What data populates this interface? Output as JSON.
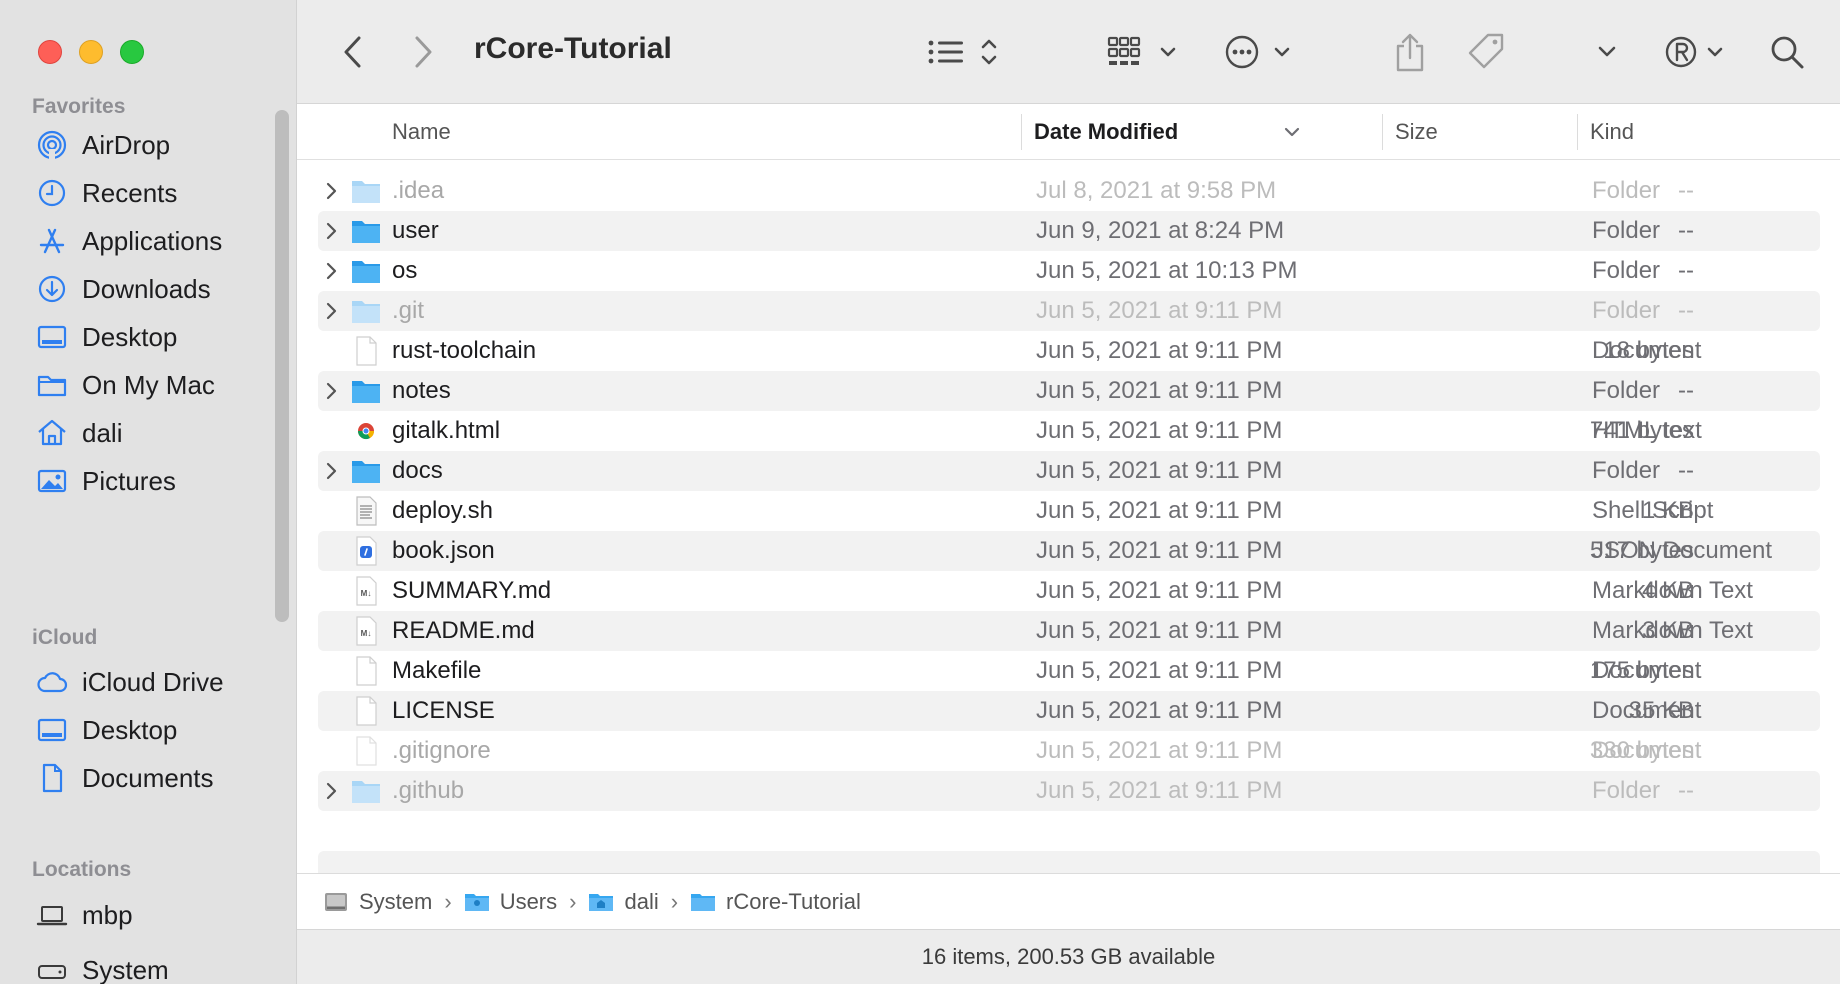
{
  "window": {
    "title": "rCore-Tutorial"
  },
  "sidebar": {
    "sections": [
      {
        "label": "Favorites",
        "items": [
          {
            "label": "AirDrop",
            "icon": "airdrop-icon"
          },
          {
            "label": "Recents",
            "icon": "clock-icon"
          },
          {
            "label": "Applications",
            "icon": "applications-icon"
          },
          {
            "label": "Downloads",
            "icon": "download-icon"
          },
          {
            "label": "Desktop",
            "icon": "desktop-icon"
          },
          {
            "label": "On My Mac",
            "icon": "folder-icon"
          },
          {
            "label": "dali",
            "icon": "home-icon"
          },
          {
            "label": "Pictures",
            "icon": "pictures-icon"
          }
        ]
      },
      {
        "label": "iCloud",
        "items": [
          {
            "label": "iCloud Drive",
            "icon": "cloud-icon"
          },
          {
            "label": "Desktop",
            "icon": "desktop-icon"
          },
          {
            "label": "Documents",
            "icon": "document-icon"
          }
        ]
      },
      {
        "label": "Locations",
        "items": [
          {
            "label": "mbp",
            "icon": "laptop-icon"
          },
          {
            "label": "System",
            "icon": "drive-icon"
          }
        ]
      }
    ]
  },
  "columns": {
    "name": "Name",
    "date": "Date Modified",
    "size": "Size",
    "kind": "Kind"
  },
  "files": [
    {
      "name": ".idea",
      "date": "Jul 8, 2021 at 9:58 PM",
      "size": "--",
      "kind": "Folder",
      "type": "folder",
      "dim": true,
      "expandable": true
    },
    {
      "name": "user",
      "date": "Jun 9, 2021 at 8:24 PM",
      "size": "--",
      "kind": "Folder",
      "type": "folder",
      "dim": false,
      "expandable": true
    },
    {
      "name": "os",
      "date": "Jun 5, 2021 at 10:13 PM",
      "size": "--",
      "kind": "Folder",
      "type": "folder",
      "dim": false,
      "expandable": true
    },
    {
      "name": ".git",
      "date": "Jun 5, 2021 at 9:11 PM",
      "size": "--",
      "kind": "Folder",
      "type": "folder",
      "dim": true,
      "expandable": true
    },
    {
      "name": "rust-toolchain",
      "date": "Jun 5, 2021 at 9:11 PM",
      "size": "18 bytes",
      "kind": "Document",
      "type": "doc",
      "dim": false,
      "expandable": false
    },
    {
      "name": "notes",
      "date": "Jun 5, 2021 at 9:11 PM",
      "size": "--",
      "kind": "Folder",
      "type": "folder",
      "dim": false,
      "expandable": true
    },
    {
      "name": "gitalk.html",
      "date": "Jun 5, 2021 at 9:11 PM",
      "size": "741 bytes",
      "kind": "HTML text",
      "type": "html",
      "dim": false,
      "expandable": false
    },
    {
      "name": "docs",
      "date": "Jun 5, 2021 at 9:11 PM",
      "size": "--",
      "kind": "Folder",
      "type": "folder",
      "dim": false,
      "expandable": true
    },
    {
      "name": "deploy.sh",
      "date": "Jun 5, 2021 at 9:11 PM",
      "size": "1 KB",
      "kind": "Shell Script",
      "type": "script",
      "dim": false,
      "expandable": false
    },
    {
      "name": "book.json",
      "date": "Jun 5, 2021 at 9:11 PM",
      "size": "517 bytes",
      "kind": "JSON Document",
      "type": "json",
      "dim": false,
      "expandable": false
    },
    {
      "name": "SUMMARY.md",
      "date": "Jun 5, 2021 at 9:11 PM",
      "size": "4 KB",
      "kind": "Markdown Text",
      "type": "md",
      "dim": false,
      "expandable": false
    },
    {
      "name": "README.md",
      "date": "Jun 5, 2021 at 9:11 PM",
      "size": "3 KB",
      "kind": "Markdown Text",
      "type": "md",
      "dim": false,
      "expandable": false
    },
    {
      "name": "Makefile",
      "date": "Jun 5, 2021 at 9:11 PM",
      "size": "175 bytes",
      "kind": "Document",
      "type": "doc",
      "dim": false,
      "expandable": false
    },
    {
      "name": "LICENSE",
      "date": "Jun 5, 2021 at 9:11 PM",
      "size": "35 KB",
      "kind": "Document",
      "type": "doc",
      "dim": false,
      "expandable": false
    },
    {
      "name": ".gitignore",
      "date": "Jun 5, 2021 at 9:11 PM",
      "size": "330 bytes",
      "kind": "Document",
      "type": "doc",
      "dim": true,
      "expandable": false
    },
    {
      "name": ".github",
      "date": "Jun 5, 2021 at 9:11 PM",
      "size": "--",
      "kind": "Folder",
      "type": "folder",
      "dim": true,
      "expandable": true
    }
  ],
  "pathbar": [
    "System",
    "Users",
    "dali",
    "rCore-Tutorial"
  ],
  "status": "16 items, 200.53 GB available",
  "colors": {
    "folder": "#36a7f0",
    "accent": "#2f7ff0",
    "sidebar_bg": "#e2e2e2"
  }
}
